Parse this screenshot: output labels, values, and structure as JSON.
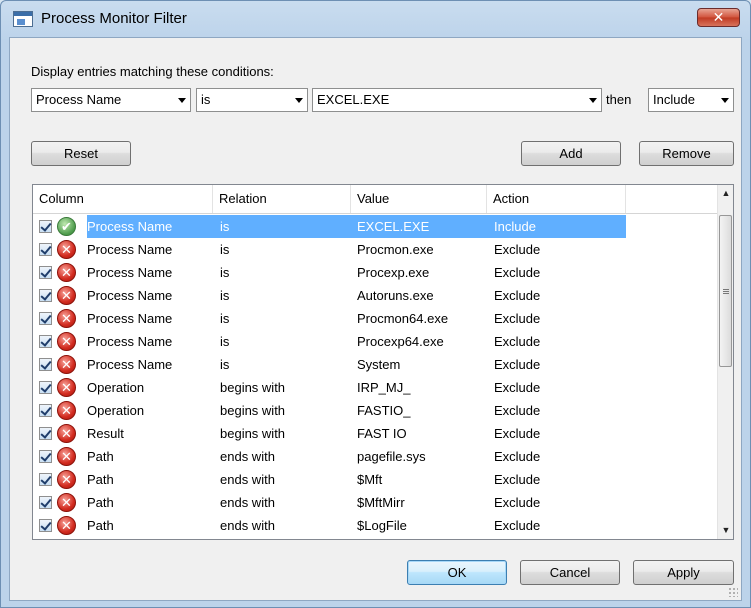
{
  "window": {
    "title": "Process Monitor Filter",
    "close_label": "✕"
  },
  "condition": {
    "label": "Display entries matching these conditions:",
    "column": "Process Name",
    "relation": "is",
    "value": "EXCEL.EXE",
    "then_label": "then",
    "action": "Include"
  },
  "buttons": {
    "reset": "Reset",
    "add": "Add",
    "remove": "Remove",
    "ok": "OK",
    "cancel": "Cancel",
    "apply": "Apply"
  },
  "list": {
    "headers": [
      "Column",
      "Relation",
      "Value",
      "Action"
    ],
    "rows": [
      {
        "checked": true,
        "status": "include",
        "column": "Process Name",
        "relation": "is",
        "value": "EXCEL.EXE",
        "action": "Include",
        "selected": true
      },
      {
        "checked": true,
        "status": "exclude",
        "column": "Process Name",
        "relation": "is",
        "value": "Procmon.exe",
        "action": "Exclude"
      },
      {
        "checked": true,
        "status": "exclude",
        "column": "Process Name",
        "relation": "is",
        "value": "Procexp.exe",
        "action": "Exclude"
      },
      {
        "checked": true,
        "status": "exclude",
        "column": "Process Name",
        "relation": "is",
        "value": "Autoruns.exe",
        "action": "Exclude"
      },
      {
        "checked": true,
        "status": "exclude",
        "column": "Process Name",
        "relation": "is",
        "value": "Procmon64.exe",
        "action": "Exclude"
      },
      {
        "checked": true,
        "status": "exclude",
        "column": "Process Name",
        "relation": "is",
        "value": "Procexp64.exe",
        "action": "Exclude"
      },
      {
        "checked": true,
        "status": "exclude",
        "column": "Process Name",
        "relation": "is",
        "value": "System",
        "action": "Exclude"
      },
      {
        "checked": true,
        "status": "exclude",
        "column": "Operation",
        "relation": "begins with",
        "value": "IRP_MJ_",
        "action": "Exclude"
      },
      {
        "checked": true,
        "status": "exclude",
        "column": "Operation",
        "relation": "begins with",
        "value": "FASTIO_",
        "action": "Exclude"
      },
      {
        "checked": true,
        "status": "exclude",
        "column": "Result",
        "relation": "begins with",
        "value": "FAST IO",
        "action": "Exclude"
      },
      {
        "checked": true,
        "status": "exclude",
        "column": "Path",
        "relation": "ends with",
        "value": "pagefile.sys",
        "action": "Exclude"
      },
      {
        "checked": true,
        "status": "exclude",
        "column": "Path",
        "relation": "ends with",
        "value": "$Mft",
        "action": "Exclude"
      },
      {
        "checked": true,
        "status": "exclude",
        "column": "Path",
        "relation": "ends with",
        "value": "$MftMirr",
        "action": "Exclude"
      },
      {
        "checked": true,
        "status": "exclude",
        "column": "Path",
        "relation": "ends with",
        "value": "$LogFile",
        "action": "Exclude"
      }
    ]
  },
  "icons": {
    "include": "check-circle-icon",
    "exclude": "x-circle-icon",
    "include_glyph": "✔",
    "exclude_glyph": "✕"
  },
  "scrollbar": {
    "up": "▲",
    "down": "▼"
  }
}
